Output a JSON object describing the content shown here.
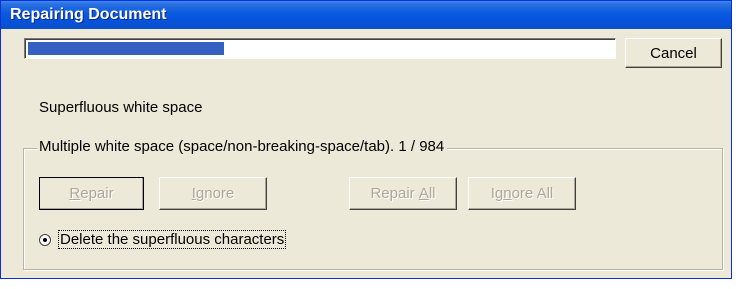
{
  "window": {
    "title": "Repairing Document"
  },
  "progress": {
    "fraction": 0.335
  },
  "buttons": {
    "cancel": "Cancel",
    "repair": {
      "mnemonic": "R",
      "rest": "epair"
    },
    "ignore": {
      "mnemonic": "I",
      "rest": "gnore"
    },
    "repair_all": {
      "before": "Repair ",
      "mnemonic": "A",
      "rest": "ll"
    },
    "ignore_all": {
      "before": "Ig",
      "mnemonic": "n",
      "rest": "ore All"
    }
  },
  "issue_label": "Superfluous white space",
  "group": {
    "legend": "Multiple white space (space/non-breaking-space/tab).  1 / 984"
  },
  "option": {
    "label": "Delete the superfluous characters",
    "selected": true
  },
  "colors": {
    "titlebar": "#0653dc",
    "progress_fill": "#3461c1",
    "dialog_bg": "#ece9d8",
    "disabled_text": "#aca899"
  }
}
